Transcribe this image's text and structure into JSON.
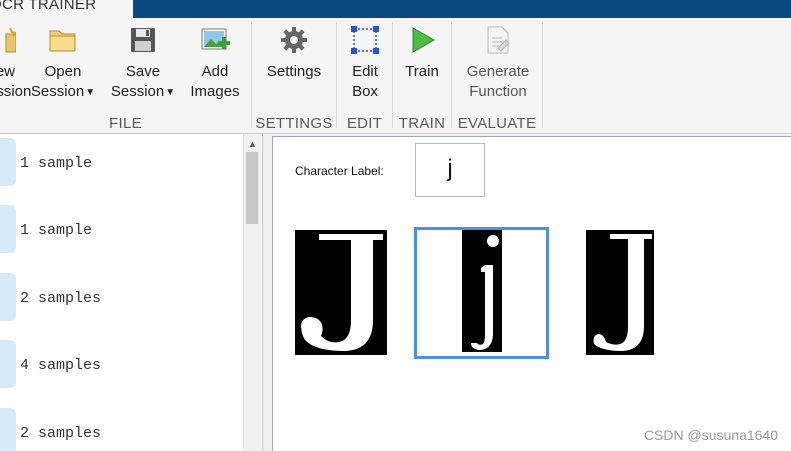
{
  "window": {
    "tab_title": "OCR TRAINER"
  },
  "toolstrip": {
    "file": {
      "label": "FILE",
      "new_session": {
        "line1": "New",
        "line2": "Session"
      },
      "open_session": {
        "line1": "Open",
        "line2": "Session"
      },
      "save_session": {
        "line1": "Save",
        "line2": "Session"
      },
      "add_images": {
        "line1": "Add",
        "line2": "Images"
      }
    },
    "settings": {
      "label": "SETTINGS",
      "button": "Settings"
    },
    "edit": {
      "label": "EDIT",
      "line1": "Edit",
      "line2": "Box"
    },
    "train": {
      "label": "TRAIN",
      "button": "Train"
    },
    "evaluate": {
      "label": "EVALUATE",
      "line1": "Generate",
      "line2": "Function"
    }
  },
  "sample_list": {
    "items": [
      {
        "count": "1 sample"
      },
      {
        "count": "1 sample"
      },
      {
        "count": "2 samples"
      },
      {
        "count": "4 samples"
      },
      {
        "count": "2 samples"
      }
    ]
  },
  "editor": {
    "character_label_caption": "Character Label:",
    "character_label_value": "j",
    "samples": [
      {
        "char": "J",
        "selected": false
      },
      {
        "char": "j",
        "selected": true
      },
      {
        "char": "J",
        "selected": false
      }
    ]
  },
  "watermark": "CSDN @susuna1640",
  "colors": {
    "title_bar": "#0b4a80",
    "selection": "#4f8fe0",
    "list_thumb": "#d5ebfa"
  }
}
